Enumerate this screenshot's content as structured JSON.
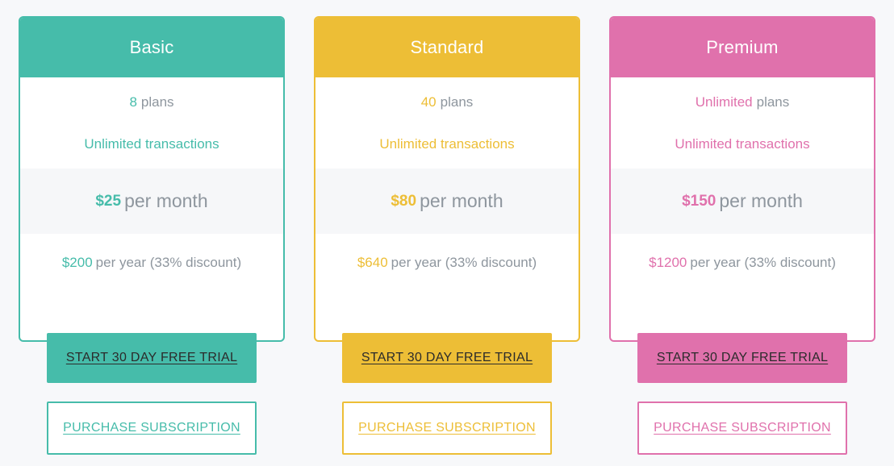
{
  "page": {
    "background_color": "#f7f8fa"
  },
  "common": {
    "trial_button_label": "START 30 DAY FREE TRIAL",
    "purchase_button_label": "PURCHASE SUBSCRIPTION",
    "plans_suffix": "plans",
    "transactions_label": "Unlimited transactions",
    "per_month_label": "per month",
    "per_year_label": "per year (33% discount)",
    "muted_text_color": "#8e969e",
    "price_row_background": "#f6f7f9"
  },
  "plans": [
    {
      "name": "Basic",
      "accent_color": "#46bcaa",
      "plans_count": "8",
      "transactions": "Unlimited transactions",
      "monthly_price": "$25",
      "monthly_period": "per month",
      "yearly_price": "$200",
      "yearly_note": "per year (33% discount)",
      "trial_label": "START 30 DAY FREE TRIAL",
      "purchase_label": "PURCHASE SUBSCRIPTION"
    },
    {
      "name": "Standard",
      "accent_color": "#edbe36",
      "plans_count": "40",
      "transactions": "Unlimited transactions",
      "monthly_price": "$80",
      "monthly_period": "per month",
      "yearly_price": "$640",
      "yearly_note": "per year (33% discount)",
      "trial_label": "START 30 DAY FREE TRIAL",
      "purchase_label": "PURCHASE SUBSCRIPTION"
    },
    {
      "name": "Premium",
      "accent_color": "#e071ac",
      "plans_count": "Unlimited",
      "transactions": "Unlimited transactions",
      "monthly_price": "$150",
      "monthly_period": "per month",
      "yearly_price": "$1200",
      "yearly_note": "per year (33% discount)",
      "trial_label": "START 30 DAY FREE TRIAL",
      "purchase_label": "PURCHASE SUBSCRIPTION"
    }
  ]
}
